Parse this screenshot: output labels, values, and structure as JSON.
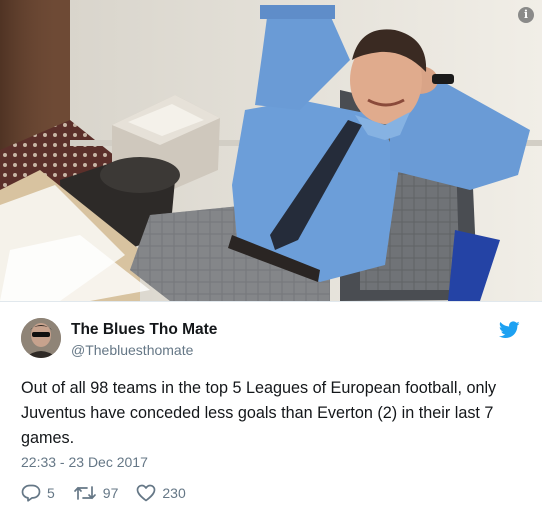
{
  "photo": {
    "alt_icon": "info-icon",
    "info_badge": "i"
  },
  "tweet": {
    "display_name": "The Blues Tho Mate",
    "handle": "@Thebluesthomate",
    "text": "Out of all 98 teams in the top 5 Leagues of European football, only Juventus have conceded less goals than Everton (2) in their last 7 games.",
    "timestamp": "22:33 - 23 Dec 2017",
    "replies": "5",
    "retweets": "97",
    "likes": "230",
    "icons": {
      "avatar": "avatar-photo",
      "platform": "twitter-bird-icon",
      "reply": "reply-icon",
      "retweet": "retweet-icon",
      "like": "heart-icon"
    },
    "colors": {
      "brand_blue": "#1da1f2",
      "name": "#14171a",
      "muted": "#657786"
    }
  }
}
